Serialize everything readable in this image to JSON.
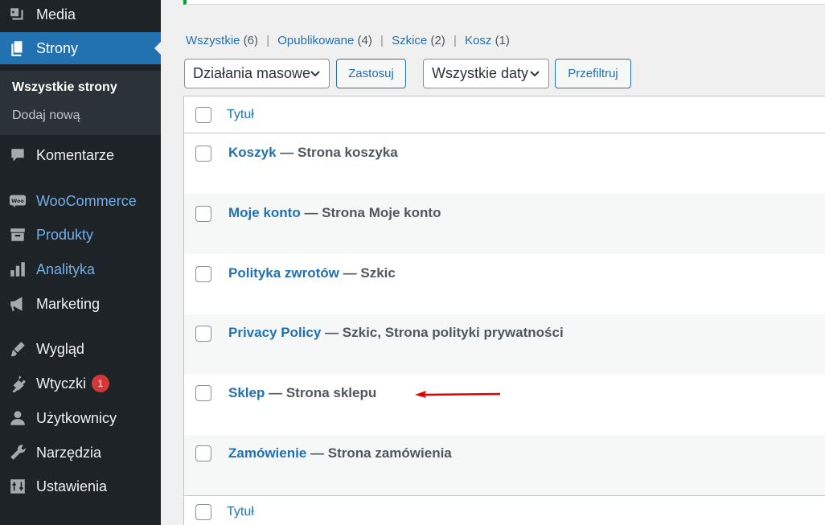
{
  "sidebar": {
    "items": [
      {
        "label": "Media",
        "icon": "media-icon"
      },
      {
        "label": "Strony",
        "icon": "pages-icon"
      },
      {
        "label": "Komentarze",
        "icon": "comments-icon"
      },
      {
        "label": "WooCommerce",
        "icon": "woo-icon"
      },
      {
        "label": "Produkty",
        "icon": "products-icon"
      },
      {
        "label": "Analityka",
        "icon": "analytics-icon"
      },
      {
        "label": "Marketing",
        "icon": "megaphone-icon"
      },
      {
        "label": "Wygląd",
        "icon": "brush-icon"
      },
      {
        "label": "Wtyczki",
        "icon": "plugin-icon",
        "badge": "1"
      },
      {
        "label": "Użytkownicy",
        "icon": "user-icon"
      },
      {
        "label": "Narzędzia",
        "icon": "wrench-icon"
      },
      {
        "label": "Ustawienia",
        "icon": "settings-icon"
      }
    ],
    "submenu": [
      {
        "label": "Wszystkie strony"
      },
      {
        "label": "Dodaj nową"
      }
    ]
  },
  "filters": {
    "views": [
      {
        "label": "Wszystkie",
        "count": "(6)"
      },
      {
        "label": "Opublikowane",
        "count": "(4)"
      },
      {
        "label": "Szkice",
        "count": "(2)"
      },
      {
        "label": "Kosz",
        "count": "(1)"
      }
    ],
    "bulk_select": "Działania masowe",
    "apply_button": "Zastosuj",
    "date_select": "Wszystkie daty",
    "filter_button": "Przefiltruj"
  },
  "table": {
    "header_title": "Tytuł",
    "footer_title": "Tytuł",
    "rows": [
      {
        "title": "Koszyk",
        "state": "— Strona koszyka"
      },
      {
        "title": "Moje konto",
        "state": "— Strona Moje konto"
      },
      {
        "title": "Polityka zwrotów",
        "state": "— Szkic"
      },
      {
        "title": "Privacy Policy",
        "state": "— Szkic, Strona polityki prywatności"
      },
      {
        "title": "Sklep",
        "state": "— Strona sklepu"
      },
      {
        "title": "Zamówienie",
        "state": "— Strona zamówienia"
      }
    ]
  },
  "colors": {
    "sidebar_bg": "#1d2327",
    "active_bg": "#2271b1",
    "link": "#2271b1",
    "badge": "#d63638",
    "annotation_arrow": "#e00000"
  }
}
